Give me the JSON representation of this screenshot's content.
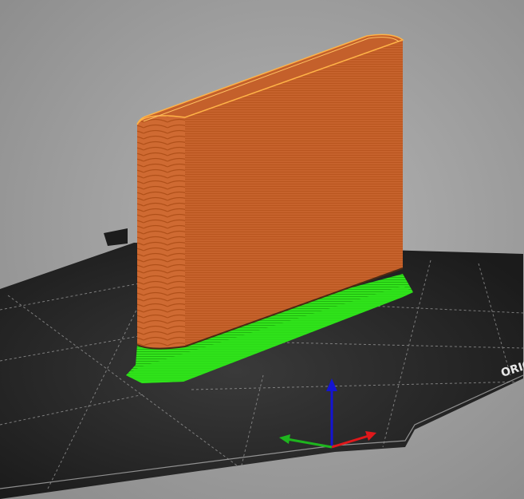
{
  "viewport": {
    "background": "#a0a0a0",
    "bed_color": "#1e1e1e",
    "bed_logo_text": "ORIG"
  },
  "model": {
    "body_color": "#c8602a",
    "edge_highlight": "#ffb347",
    "first_layers_color": "#2fe21a"
  },
  "axes": {
    "x_color": "#e0181b",
    "y_color": "#1eb51e",
    "z_color": "#1414d2"
  }
}
